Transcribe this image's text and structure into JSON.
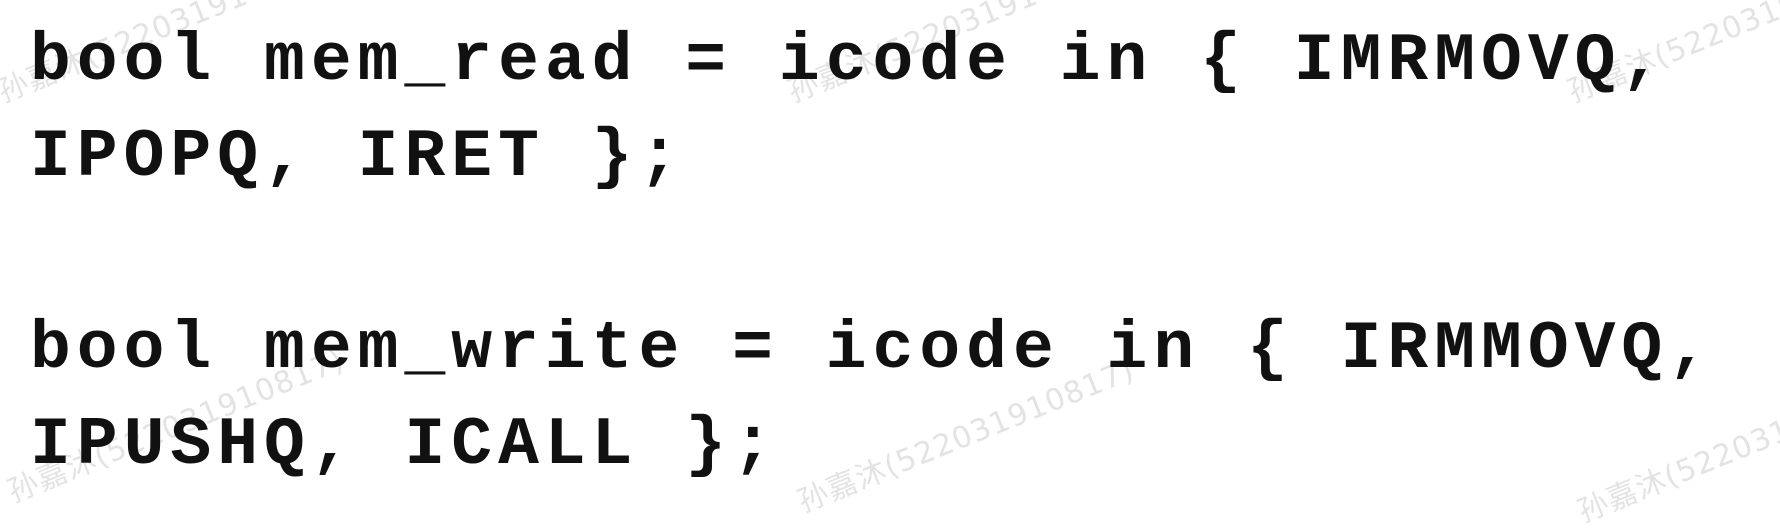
{
  "watermark": {
    "text": "孙嘉沐(522031910817)"
  },
  "code": {
    "lines": [
      "bool mem_read = icode in { IMRMOVQ,",
      "IPOPQ, IRET };",
      "",
      "bool mem_write = icode in { IRMMOVQ,",
      "IPUSHQ, ICALL };"
    ]
  }
}
